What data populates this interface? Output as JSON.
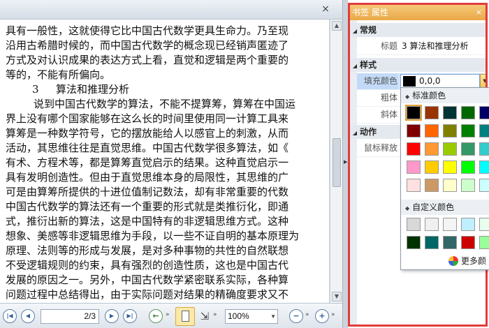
{
  "viewer": {
    "close_glyph": "×",
    "lines": [
      {
        "cls": "",
        "text": "具有一般性，这就使得它比中国古代数学更具生命力。乃至现"
      },
      {
        "cls": "",
        "text": "沿用古希腊时候的，而中国古代数学的概念现已经销声匿迹了"
      },
      {
        "cls": "",
        "text": "方式及对认识成果的表达方式上看，直觉和逻辑是两个重要的"
      },
      {
        "cls": "",
        "text": "等的，不能有所偏向。"
      },
      {
        "cls": "heading",
        "num": "3",
        "text": "算法和推理分析"
      },
      {
        "cls": "indent",
        "text": "说到中国古代数学的算法，不能不提算筹，算筹在中国运"
      },
      {
        "cls": "",
        "text": "界上没有哪个国家能够在这么长的时间里使用同一计算工具来"
      },
      {
        "cls": "",
        "text": "算筹是一种数学符号，它的摆放能给人以感官上的刺激，从而"
      },
      {
        "cls": "",
        "text": "活动，其思维往往是直觉思维。中国古代数学很多算法，如《"
      },
      {
        "cls": "",
        "text": "有术、方程术等，都是算筹直觉启示的结果。这种直觉启示一"
      },
      {
        "cls": "",
        "text": "具有发明创造性。但由于直觉思维本身的局限性，其思维的广"
      },
      {
        "cls": "",
        "text": "可是由算筹所提供的十进位值制记数法，却有非常重要的代数"
      },
      {
        "cls": "",
        "text": "中国古代数学的算法还有一个重要的形式就是类推衍化，即通"
      },
      {
        "cls": "",
        "text": "式，推衍出新的算法，这是中国特有的非逻辑思维方式。这种"
      },
      {
        "cls": "",
        "text": "想象、美感等非逻辑思维为手段，以一些不证自明的基本原理为"
      },
      {
        "cls": "",
        "text": "原理、法则等的形成与发展，是对多种事物的共性的自然联想"
      },
      {
        "cls": "",
        "text": "不受逻辑规则的约束，具有强烈的创造性质，这也是中国古代"
      },
      {
        "cls": "",
        "text": "发展的原因之一。另外，中国古代数学紧密联系实际，各种算"
      },
      {
        "cls": "",
        "text": "问题过程中总结得出，由于实际问题对结果的精确度要求又不"
      }
    ]
  },
  "toolbar": {
    "first_glyph": "|◀",
    "prev_glyph": "◀",
    "page_value": "2/3",
    "next_glyph": "▶",
    "last_glyph": "▶|",
    "back_glyph": "←",
    "chevron_glyph": "»",
    "fit_width_glyph": "⇲",
    "zoom_value": "100%",
    "dropdown_glyph": "▼",
    "zoom_out_glyph": "−",
    "zoom_in_glyph": "+"
  },
  "panel": {
    "title": "书签 属性",
    "close_glyph": "×",
    "collapse_glyph": "◢",
    "sections": {
      "general": "常规",
      "style": "样式",
      "action": "动作"
    },
    "props": {
      "title_label": "标题",
      "title_value": "3 算法和推理分析",
      "fill_label": "填充颜色",
      "fill_value": "0,0,0",
      "bold_label": "粗体",
      "italic_label": "斜体",
      "mouse_release_label": "鼠标释放"
    }
  },
  "color_popup": {
    "standard_label": "标准颜色",
    "custom_label": "自定义颜色",
    "diamond_glyph": "◆",
    "more_label": "更多颜色...",
    "standard_colors": [
      "#000000",
      "#993300",
      "#003333",
      "#006600",
      "#000066",
      "#800000",
      "#ff6600",
      "#808000",
      "#008000",
      "#008080",
      "#ff0000",
      "#ff9933",
      "#99cc00",
      "#339966",
      "#33cccc",
      "#ff99cc",
      "#ffcc00",
      "#ffff00",
      "#00ff00",
      "#00ffff",
      "#ffe0e0",
      "#cc9966",
      "#ffffcc",
      "#ccffcc",
      "#ccffff"
    ],
    "custom_colors": [
      "#d8d8d8",
      "#f0f0f0",
      "#f4f4f4",
      "#bff0ff",
      "#e8fff0",
      "#003300",
      "#006666",
      "#336666",
      "#cc0000",
      "#99ff99"
    ],
    "selected_index": 0
  }
}
